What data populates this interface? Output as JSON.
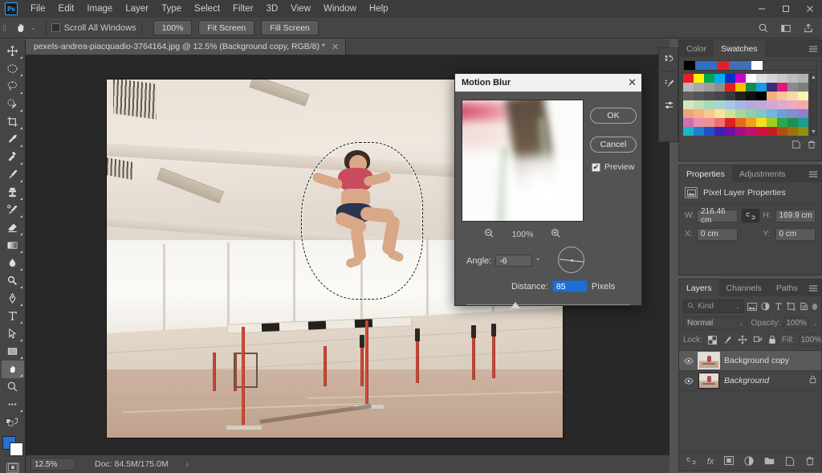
{
  "app": {
    "logo": "Ps",
    "menus": [
      "File",
      "Edit",
      "Image",
      "Layer",
      "Type",
      "Select",
      "Filter",
      "3D",
      "View",
      "Window",
      "Help"
    ],
    "window_controls": {
      "minimize": "—",
      "maximize": "▢",
      "close": "✕"
    }
  },
  "options_bar": {
    "tool_icon": "hand-tool-icon",
    "caret": "⌄",
    "scroll_all_windows": {
      "label": "Scroll All Windows",
      "checked": false
    },
    "buttons": [
      "100%",
      "Fit Screen",
      "Fill Screen"
    ],
    "right_icons": [
      "search-icon",
      "workspace-icon",
      "share-icon"
    ]
  },
  "document_tab": {
    "title": "pexels-andrea-piacquadio-3764164.jpg @ 12.5% (Background copy, RGB/8) *",
    "close": "✕"
  },
  "toolbar": {
    "tools": [
      {
        "name": "move-tool",
        "glyph": "move",
        "selected": false
      },
      {
        "name": "elliptical-marquee-tool",
        "glyph": "ellipse",
        "selected": false
      },
      {
        "name": "lasso-tool",
        "glyph": "lasso",
        "selected": false
      },
      {
        "name": "quick-selection-tool",
        "glyph": "quickselect",
        "selected": false
      },
      {
        "name": "crop-tool",
        "glyph": "crop",
        "selected": false
      },
      {
        "name": "eyedropper-tool",
        "glyph": "eyedropper",
        "selected": false
      },
      {
        "name": "spot-healing-brush-tool",
        "glyph": "healing",
        "selected": false
      },
      {
        "name": "brush-tool",
        "glyph": "brush",
        "selected": false
      },
      {
        "name": "clone-stamp-tool",
        "glyph": "stamp",
        "selected": false
      },
      {
        "name": "history-brush-tool",
        "glyph": "historybrush",
        "selected": false
      },
      {
        "name": "eraser-tool",
        "glyph": "eraser",
        "selected": false
      },
      {
        "name": "gradient-tool",
        "glyph": "gradient",
        "selected": false
      },
      {
        "name": "blur-tool",
        "glyph": "blur",
        "selected": false
      },
      {
        "name": "dodge-tool",
        "glyph": "dodge",
        "selected": false
      },
      {
        "name": "pen-tool",
        "glyph": "pen",
        "selected": false
      },
      {
        "name": "type-tool",
        "glyph": "type",
        "selected": false
      },
      {
        "name": "path-selection-tool",
        "glyph": "pathselect",
        "selected": false
      },
      {
        "name": "rectangle-tool",
        "glyph": "rectangle",
        "selected": false
      },
      {
        "name": "hand-tool",
        "glyph": "hand",
        "selected": true
      },
      {
        "name": "zoom-tool",
        "glyph": "zoom",
        "selected": false
      },
      {
        "name": "edit-toolbar-button",
        "glyph": "ellipsis",
        "selected": false
      }
    ],
    "foreground_color": "#2a6fd1",
    "background_color": "#ffffff"
  },
  "status_bar": {
    "zoom": "12.5%",
    "doc_info": "Doc: 84.5M/175.0M",
    "caret": "›"
  },
  "icon_rail": [
    "history-icon",
    "brush-presets-icon",
    "adjustments-icon"
  ],
  "panels": {
    "color_swatches": {
      "tabs": [
        {
          "label": "Color",
          "active": false
        },
        {
          "label": "Swatches",
          "active": true
        }
      ],
      "menu_icon": "panel-menu-icon",
      "recent": [
        "#000000",
        "#2f6fc7",
        "#2f6fc7",
        "#e41f1f",
        "#3f6fb5",
        "#3f6fb5",
        "#ffffff"
      ],
      "grid": [
        "#ee1c25",
        "#fff200",
        "#00a64f",
        "#00aeef",
        "#0033cc",
        "#cc00cc",
        "#ffffff",
        "#e0e0e0",
        "#d4d4d4",
        "#c8c8c8",
        "#bdbdbd",
        "#b2b2b2",
        "#b8b8b8",
        "#aaaaaa",
        "#9e9e9e",
        "#8f8f8f",
        "#e0201e",
        "#f0c200",
        "#1a8a4a",
        "#1b9bd8",
        "#3b2a7a",
        "#e0187c",
        "#8a8a8a",
        "#7e7e7e",
        "#5e5e5e",
        "#565656",
        "#4e4e4e",
        "#474747",
        "#3a3a3a",
        "#222222",
        "#111111",
        "#000000",
        "#f3b07a",
        "#f6c79a",
        "#f8d8ad",
        "#fdf3b0",
        "#d6e8b9",
        "#bfe0b5",
        "#a9d8b4",
        "#a8d4d2",
        "#a6c8e6",
        "#a8b6e2",
        "#b3aade",
        "#c1a8da",
        "#d0a8d6",
        "#e0a9cf",
        "#eea9c2",
        "#f4a9a9",
        "#f2a07a",
        "#f5b382",
        "#f8c88e",
        "#fbe39a",
        "#c9e39a",
        "#a6d79a",
        "#8fd0a6",
        "#7fc9c2",
        "#6fb6e0",
        "#6f9fd8",
        "#7f8fd0",
        "#8f7fcc",
        "#cf6fb0",
        "#e88fb0",
        "#f08f8f",
        "#ee6f6f",
        "#e02020",
        "#e86a20",
        "#f0a020",
        "#f5e020",
        "#9fd020",
        "#2aa84a",
        "#1c9050",
        "#17a08a",
        "#1bb5c9",
        "#1f7fd0",
        "#2050c0",
        "#4020b0",
        "#7010a0",
        "#a0108a",
        "#c01070",
        "#d01040",
        "#c02020",
        "#b05010",
        "#a07010",
        "#909010"
      ],
      "footer_icons": [
        "new-swatch-icon",
        "delete-swatch-icon"
      ]
    },
    "properties": {
      "tabs": [
        {
          "label": "Properties",
          "active": true
        },
        {
          "label": "Adjustments",
          "active": false
        }
      ],
      "menu_icon": "panel-menu-icon",
      "header_icon": "pixel-layer-icon",
      "header_title": "Pixel Layer Properties",
      "link_icon": "link-dimensions-icon",
      "fields": {
        "w_label": "W:",
        "w_value": "216.46 cm",
        "h_label": "H:",
        "h_value": "169.9 cm",
        "x_label": "X:",
        "x_value": "0 cm",
        "y_label": "Y:",
        "y_value": "0 cm"
      }
    },
    "layers": {
      "tabs": [
        {
          "label": "Layers",
          "active": true
        },
        {
          "label": "Channels",
          "active": false
        },
        {
          "label": "Paths",
          "active": false
        }
      ],
      "menu_icon": "panel-menu-icon",
      "filter": {
        "search_icon": "search-icon",
        "kind_label": "Kind",
        "caret": "⌄",
        "filter_icons": [
          "pixel-filter-icon",
          "adjustment-filter-icon",
          "type-filter-icon",
          "shape-filter-icon",
          "smart-object-filter-icon"
        ],
        "toggle": "filter-toggle-icon"
      },
      "blend_mode": "Normal",
      "opacity_label": "Opacity:",
      "opacity_value": "100%",
      "lock_label": "Lock:",
      "lock_icons": [
        "lock-transparent-pixels-icon",
        "lock-image-pixels-icon",
        "lock-position-icon",
        "lock-artboard-icon",
        "lock-all-icon"
      ],
      "fill_label": "Fill:",
      "fill_value": "100%",
      "rows": [
        {
          "name": "Background copy",
          "visible": true,
          "selected": true,
          "locked": false,
          "italic": false
        },
        {
          "name": "Background",
          "visible": true,
          "selected": false,
          "locked": true,
          "italic": true
        }
      ],
      "footer_icons": [
        "link-layers-icon",
        "layer-styles-icon",
        "layer-mask-icon",
        "adjustment-layer-icon",
        "new-group-icon",
        "new-layer-icon",
        "delete-layer-icon"
      ]
    }
  },
  "dialog": {
    "title": "Motion Blur",
    "close": "✕",
    "ok_label": "OK",
    "cancel_label": "Cancel",
    "preview": {
      "label": "Preview",
      "checked": true,
      "check_glyph": "✔"
    },
    "zoom": {
      "out_icon": "zoom-out-icon",
      "level": "100%",
      "in_icon": "zoom-in-icon"
    },
    "angle": {
      "label": "Angle:",
      "value": "-6",
      "unit": "°",
      "dial_icon": "angle-dial-icon"
    },
    "distance": {
      "label": "Distance:",
      "value": "85",
      "unit": "Pixels",
      "selected": true
    },
    "slider": {
      "position_percent": 27
    }
  },
  "canvas": {
    "document_name": "pexels-andrea-piacquadio-3764164.jpg",
    "selection": "marching-ants-selection-around-athlete"
  }
}
